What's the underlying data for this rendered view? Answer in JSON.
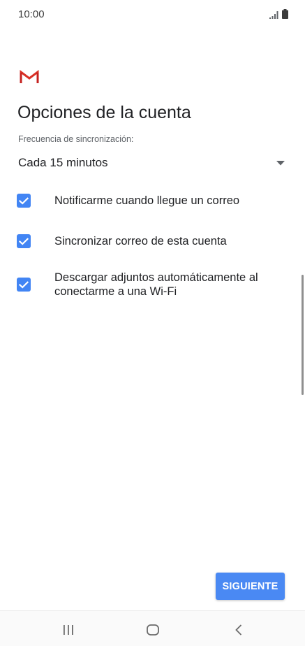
{
  "status_bar": {
    "time": "10:00",
    "icons": [
      "signal-icon",
      "battery-icon"
    ]
  },
  "app": {
    "logo": "gmail-logo-icon",
    "brand_color": "#d93025"
  },
  "page": {
    "title": "Opciones de la cuenta",
    "sync_label": "Frecuencia de sincronización:",
    "sync_value": "Cada 15 minutos",
    "options": [
      {
        "label": "Notificarme cuando llegue un correo",
        "checked": true
      },
      {
        "label": "Sincronizar correo de esta cuenta",
        "checked": true
      },
      {
        "label": "Descargar adjuntos automáticamente al conectarme a una Wi-Fi",
        "checked": true
      }
    ],
    "next_label": "SIGUIENTE"
  },
  "colors": {
    "accent": "#4285f4",
    "button": "#4a89f3"
  },
  "nav_bar": {
    "buttons": [
      "recent-apps-icon",
      "home-icon",
      "back-icon"
    ]
  }
}
